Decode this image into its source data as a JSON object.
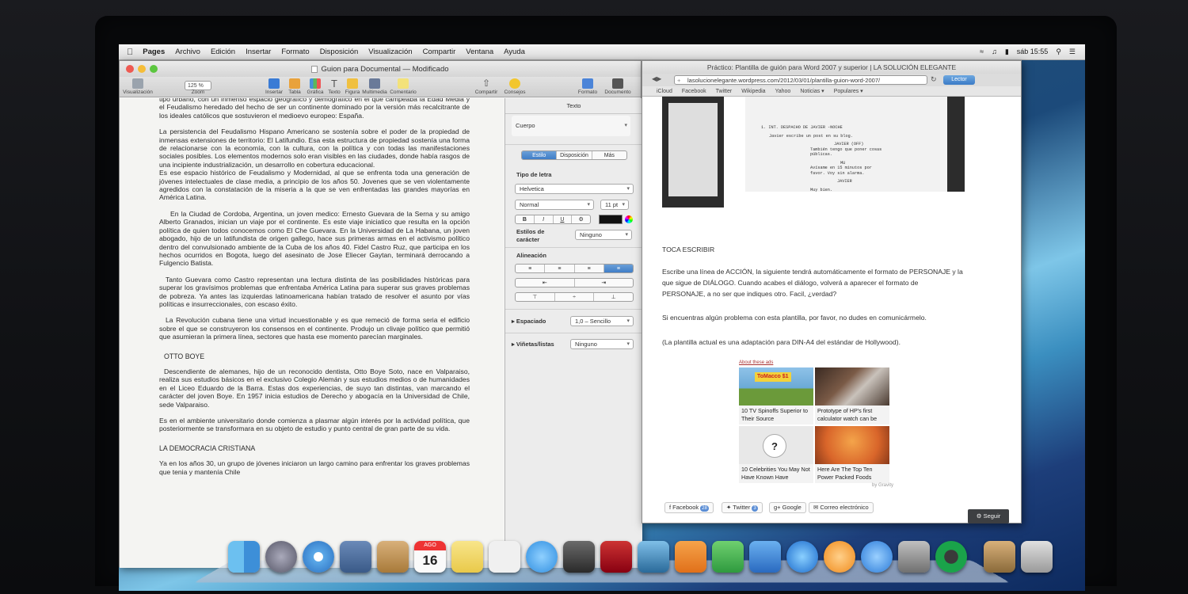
{
  "menubar": {
    "app": "Pages",
    "items": [
      "Archivo",
      "Edición",
      "Insertar",
      "Formato",
      "Disposición",
      "Visualización",
      "Compartir",
      "Ventana",
      "Ayuda"
    ],
    "clock": "sáb 15:55"
  },
  "pages": {
    "title": "Guion para Documental — Modificado",
    "toolbar": {
      "zoom": "125 %",
      "left_labels": [
        "Visualización",
        "Zoom"
      ],
      "insert_labels": [
        "Insertar",
        "Tabla",
        "Gráfica",
        "Texto",
        "Figura",
        "Multimedia",
        "Comentario"
      ],
      "share_labels": [
        "Compartir",
        "Consejos"
      ],
      "right_labels": [
        "Formato",
        "Documento"
      ]
    },
    "doc": {
      "p1": "tipo urbano, con un inmenso espacio geográfico y demográfico en el que campeaba la Edad Media y el Feudalismo heredado del hecho de ser un continente dominado por la versión más recalcitrante de los ideales católicos que sostuvieron el medioevo europeo: España.",
      "p2": "La persistencia del Feudalismo Hispano Americano se sostenía sobre el poder de la propiedad de inmensas extensiones de territorio: El Latifundio. Esa esta estructura de propiedad sostenía una forma de relacionarse con la economía, con la cultura, con la política y con todas las manifestaciones sociales posibles. Los elementos modernos solo eran visibles en las ciudades, donde había rasgos de una incipiente industrialización, un desarrollo en cobertura educacional.",
      "p3": "Es ese espacio histórico de Feudalismo y Modernidad, al que se enfrenta toda una generación de jóvenes intelectuales de clase media, a principio de los años 50. Jovenes que se ven violentamente agredidos con la constatación de la miseria a la que se ven enfrentadas las grandes mayorías en América Latina.",
      "p4": "En la Ciudad de Cordoba, Argentina, un joven medico: Ernesto Guevara de la Serna y su amigo Alberto Granados, inician un viaje por el continente. Es este viaje iniciatico que resulta en la opción política de quien todos conocemos como El Che Guevara. En la Universidad de La Habana, un joven abogado, hijo de un latifundista de origen gallego, hace sus primeras armas en el activismo político dentro del convulsionado ambiente de la Cuba de los años 40. Fidel Castro Ruz, que participa en los hechos ocurridos en Bogota, luego del asesinato de Jose Eliecer Gaytan, terminará derrocando a Fulgencio Batista.",
      "p5": "Tanto Guevara como Castro representan una lectura distinta de las posibilidades históricas para superar los gravísimos problemas que enfrentaba América Latina para superar sus graves problemas de pobreza. Ya antes las izquierdas latinoamericana habían tratado de resolver el asunto por vías políticas e insurreccionales, con escaso éxito.",
      "p6": "La Revolución cubana tiene una virtud incuestionable y es que remeció de forma seria el edificio sobre el que se construyeron los consensos en el continente. Produjo un clivaje político que permitió que asumieran la primera línea, sectores que hasta ese momento parecían marginales.",
      "h1": "OTTO BOYE",
      "p7": "Descendiente de alemanes, hijo de un reconocido dentista, Otto Boye Soto, nace en Valparaiso, realiza sus estudios básicos en el exclusivo Colegio Alemán y sus estudios medios o de humanidades en el Liceo Eduardo de la Barra. Estas dos experiencias, de suyo tan distintas, van marcando el carácter del joven Boye. En 1957 inicia estudios de Derecho y abogacía en la Universidad de Chile, sede Valparaiso.",
      "p8": "Es en el ambiente universitario donde comienza a plasmar algún interés por la actividad política, que posteriormente se transformara en su objeto de estudio y punto central de gran parte de su vida.",
      "h2": "LA DEMOCRACIA CRISTIANA",
      "p9": "Ya en los años 30, un grupo de jóvenes iniciaron un largo camino para enfrentar los graves problemas que tenia y mantenía Chile"
    },
    "inspector": {
      "header": "Texto",
      "style": "Cuerpo",
      "tabs": [
        "Estilo",
        "Disposición",
        "Más"
      ],
      "font_label": "Tipo de letra",
      "font": "Helvetica",
      "weight": "Normal",
      "size": "11 pt",
      "bius": [
        "B",
        "I",
        "U",
        "⚙"
      ],
      "char_styles_label": "Estilos de carácter",
      "char_style": "Ninguno",
      "align_label": "Alineación",
      "spacing_label": "Espaciado",
      "spacing": "1,0 – Sencillo",
      "bullets_label": "Viñetas/listas",
      "bullets": "Ninguno"
    }
  },
  "browser": {
    "title": "Práctico: Plantilla de guión para Word 2007 y superior | LA SOLUCIÓN ELEGANTE",
    "url": "lasolucionelegante.wordpress.com/2012/03/01/plantilla-guion-word-2007/",
    "reader": "Lector",
    "favorites": [
      "iCloud",
      "Facebook",
      "Twitter",
      "Wikipedia",
      "Yahoo",
      "Noticias ▾",
      "Populares ▾"
    ],
    "screenplay": {
      "line1": "1. INT. DESPACHO DE JAVIER -NOCHE",
      "line2": "Javier escribe un post en su blog.",
      "line3": "JAVIER (OFF)",
      "line4": "También tengo que poner cosas",
      "line5": "públicas.",
      "line6": "MU",
      "line7": "Avísame en 15 minutos por",
      "line8": "favor. Voy sin alarma.",
      "line9": "JAVIER",
      "line10": "Muy bien."
    },
    "heading": "TOCA ESCRIBIR",
    "para1": "Escribe una línea de ACCIÓN, la siguiente tendrá automáticamente el formato de PERSONAJE y la que sigue de DIÁLOGO. Cuando acabes el diálogo, volverá a aparecer el formato de PERSONAJE, a no ser que indiques otro. Facil, ¿verdad?",
    "para2": "Si encuentras algún problema con esta plantilla, por favor, no dudes en comunicármelo.",
    "para3": "(La plantilla actual es una adaptación para DIN-A4 del estándar de Hollywood).",
    "ads_head": "About these ads",
    "ads": [
      {
        "caption": "10 TV Spinoffs Superior to Their Source",
        "image_text": "ToMacco $1"
      },
      {
        "caption": "Prototype of HP's first calculator watch can be"
      },
      {
        "caption": "10 Celebrities You May Not Have Known Have",
        "image_text": "?"
      },
      {
        "caption": "Here Are The Top Ten Power Packed Foods"
      }
    ],
    "gravity": "by Gravity",
    "share": {
      "facebook": "Facebook",
      "facebook_count": "28",
      "twitter": "Twitter",
      "twitter_count": "3",
      "google": "Google",
      "email": "Correo electrónico"
    },
    "follow": "Seguir"
  },
  "dock": {
    "calendar_month": "AGO",
    "calendar_day": "16",
    "icons": [
      "finder-icon",
      "launchpad-icon",
      "safari-icon",
      "preview-icon",
      "contacts-icon",
      "calendar-icon",
      "notes-icon",
      "reminders-icon",
      "messages-icon",
      "facetime-icon",
      "photo-booth-icon",
      "iphoto-icon",
      "pages-icon",
      "numbers-icon",
      "keynote-icon",
      "itunes-icon",
      "ibooks-icon",
      "app-store-icon",
      "system-preferences-icon",
      "spotify-icon",
      "downloads-icon",
      "trash-icon"
    ]
  }
}
